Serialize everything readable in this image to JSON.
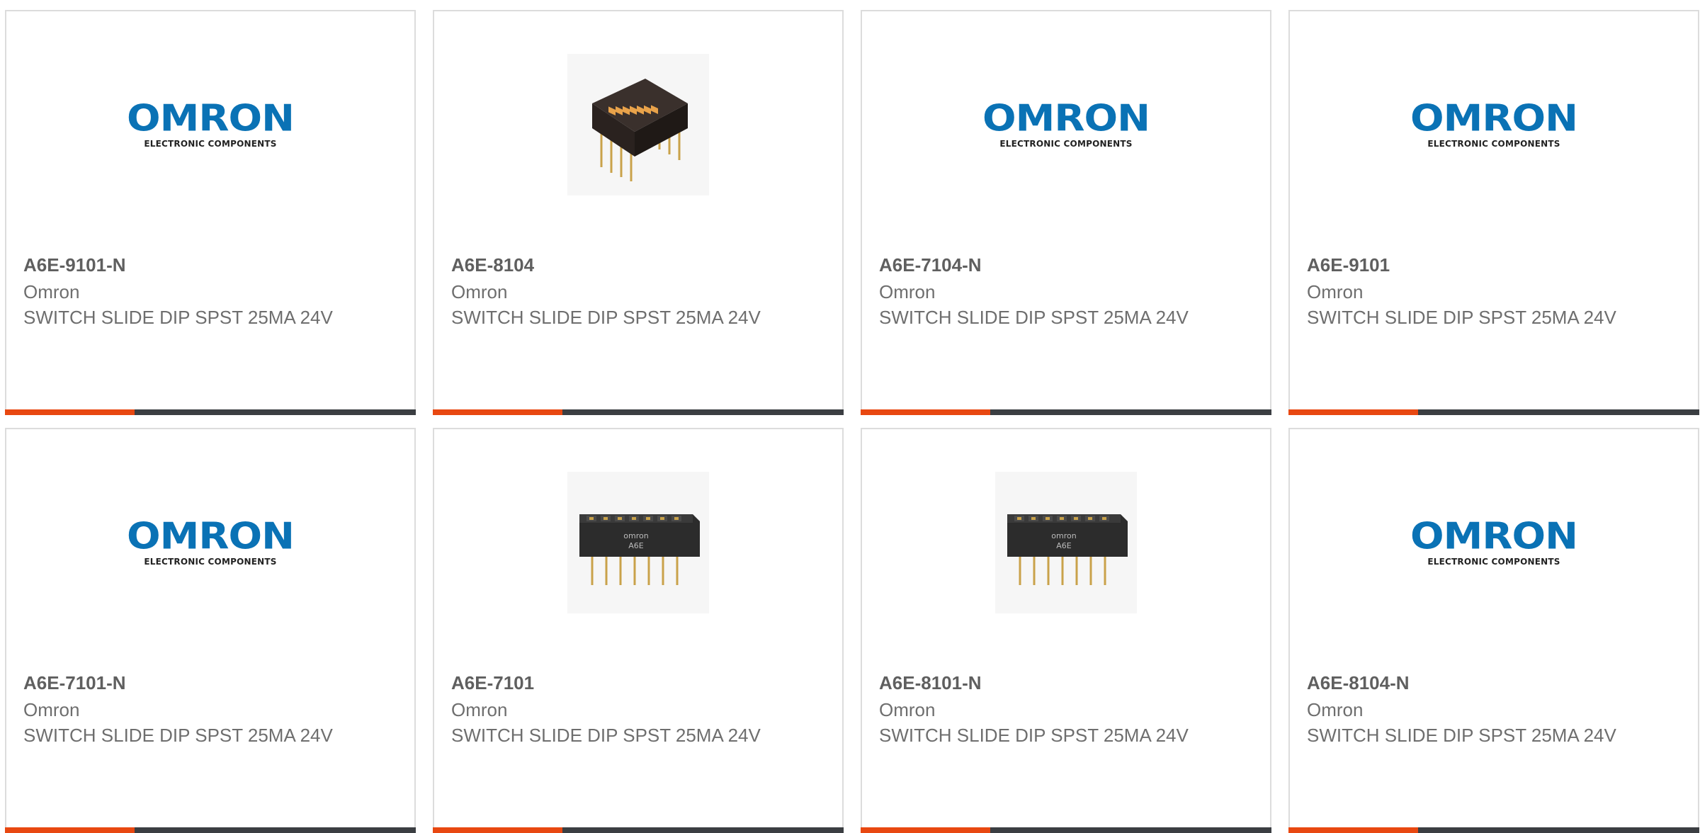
{
  "logo": {
    "word": "OMRON",
    "subtitle": "ELECTRONIC COMPONENTS",
    "color": "#0a72b5"
  },
  "colors": {
    "accent": "#e84811",
    "bar": "#3b3e42",
    "border": "#dcdcdc",
    "text": "#6e6e6e"
  },
  "products": [
    {
      "part_number": "A6E-9101-N",
      "manufacturer": "Omron",
      "description": "SWITCH SLIDE DIP SPST 25MA 24V",
      "image": "omron-logo"
    },
    {
      "part_number": "A6E-8104",
      "manufacturer": "Omron",
      "description": "SWITCH SLIDE DIP SPST 25MA 24V",
      "image": "dip-switch-photo-angled"
    },
    {
      "part_number": "A6E-7104-N",
      "manufacturer": "Omron",
      "description": "SWITCH SLIDE DIP SPST 25MA 24V",
      "image": "omron-logo"
    },
    {
      "part_number": "A6E-9101",
      "manufacturer": "Omron",
      "description": "SWITCH SLIDE DIP SPST 25MA 24V",
      "image": "omron-logo"
    },
    {
      "part_number": "A6E-7101-N",
      "manufacturer": "Omron",
      "description": "SWITCH SLIDE DIP SPST 25MA 24V",
      "image": "omron-logo"
    },
    {
      "part_number": "A6E-7101",
      "manufacturer": "Omron",
      "description": "SWITCH SLIDE DIP SPST 25MA 24V",
      "image": "dip-switch-photo-front"
    },
    {
      "part_number": "A6E-8101-N",
      "manufacturer": "Omron",
      "description": "SWITCH SLIDE DIP SPST 25MA 24V",
      "image": "dip-switch-photo-front"
    },
    {
      "part_number": "A6E-8104-N",
      "manufacturer": "Omron",
      "description": "SWITCH SLIDE DIP SPST 25MA 24V",
      "image": "omron-logo"
    }
  ]
}
